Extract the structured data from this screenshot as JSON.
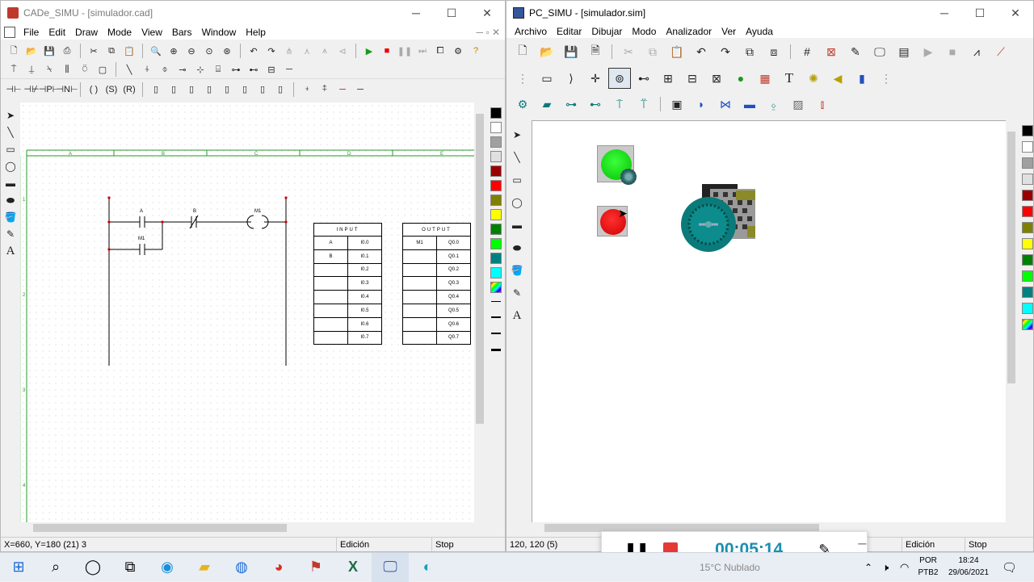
{
  "cade": {
    "title": "CADe_SIMU - [simulador.cad]",
    "menu": [
      "File",
      "Edit",
      "Draw",
      "Mode",
      "View",
      "Bars",
      "Window",
      "Help"
    ],
    "col_letters": [
      "A",
      "B",
      "C",
      "D",
      "E"
    ],
    "row_numbers": [
      "1",
      "2",
      "3",
      "4"
    ],
    "ladder": {
      "contact_a": "A",
      "contact_b": "B",
      "coil": "M1",
      "contact_m1": "M1"
    },
    "input_table": {
      "header": "INPUT",
      "rows": [
        [
          "A",
          "I0.0"
        ],
        [
          "B",
          "I0.1"
        ],
        [
          "",
          "I0.2"
        ],
        [
          "",
          "I0.3"
        ],
        [
          "",
          "I0.4"
        ],
        [
          "",
          "I0.5"
        ],
        [
          "",
          "I0.6"
        ],
        [
          "",
          "I0.7"
        ]
      ]
    },
    "output_table": {
      "header": "OUTPUT",
      "rows": [
        [
          "M1",
          "Q0.0"
        ],
        [
          "",
          "Q0.1"
        ],
        [
          "",
          "Q0.2"
        ],
        [
          "",
          "Q0.3"
        ],
        [
          "",
          "Q0.4"
        ],
        [
          "",
          "Q0.5"
        ],
        [
          "",
          "Q0.6"
        ],
        [
          "",
          "Q0.7"
        ]
      ]
    },
    "status": {
      "coords": "X=660, Y=180 (21) 3",
      "mode": "Edición",
      "state": "Stop"
    }
  },
  "pcsimu": {
    "title": "PC_SIMU - [simulador.sim]",
    "menu": [
      "Archivo",
      "Editar",
      "Dibujar",
      "Modo",
      "Analizador",
      "Ver",
      "Ayuda"
    ],
    "status": {
      "coords": "120, 120 (5)",
      "mode": "Edición",
      "state": "Stop"
    }
  },
  "recorder": {
    "time": "00:05:14"
  },
  "taskbar": {
    "weather": "15°C Nublado",
    "lang1": "POR",
    "lang2": "PTB2",
    "time": "18:24",
    "date": "29/06/2021"
  },
  "colors": {
    "palette": [
      "#000000",
      "#ffffff",
      "#a0a0a0",
      "#e0e0e0",
      "#9b0000",
      "#ff0000",
      "#808000",
      "#ffff00",
      "#008000",
      "#00ff00",
      "#008080",
      "#00ffff"
    ],
    "accent_time": "#1a8fb0",
    "grid_green": "#2a9a2a"
  }
}
